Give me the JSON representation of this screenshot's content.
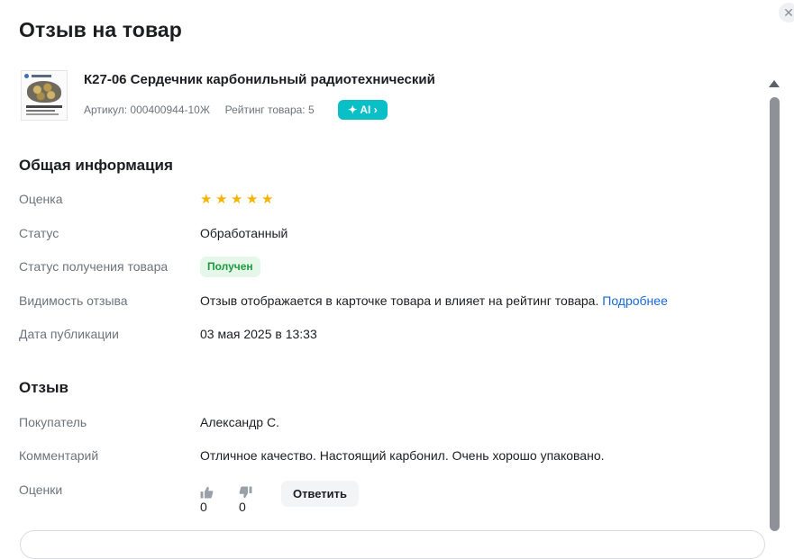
{
  "dialog": {
    "title": "Отзыв на товар",
    "close_icon": "close-icon"
  },
  "product": {
    "name": "К27-06 Сердечник карбонильный радиотехнический",
    "article_label": "Артикул:",
    "article_value": "000400944-10Ж",
    "rating_label": "Рейтинг товара:",
    "rating_value": "5",
    "ai_badge_label": "AI",
    "ai_badge_icon": "sparkle-icon",
    "ai_badge_arrow": "chevron-right-icon"
  },
  "general": {
    "title": "Общая информация",
    "rating_label": "Оценка",
    "rating_value": 5,
    "rating_max": 5,
    "status_label": "Статус",
    "status_value": "Обработанный",
    "receipt_label": "Статус получения товара",
    "receipt_value": "Получен",
    "visibility_label": "Видимость отзыва",
    "visibility_text": "Отзыв отображается в карточке товара и влияет на рейтинг товара.",
    "visibility_link": "Подробнее",
    "date_label": "Дата публикации",
    "date_value": "03 мая 2025 в 13:33"
  },
  "review": {
    "title": "Отзыв",
    "buyer_label": "Покупатель",
    "buyer_value": "Александр С.",
    "comment_label": "Комментарий",
    "comment_value": "Отличное качество. Настоящий карбонил. Очень хорошо упаковано.",
    "votes_label": "Оценки",
    "likes": "0",
    "dislikes": "0",
    "reply_label": "Ответить"
  },
  "colors": {
    "accent_link": "#1767d6",
    "ai_badge": "#0bbfc7",
    "star": "#f5b400",
    "received_bg": "#e4f7e9",
    "received_text": "#1b9b3d"
  }
}
